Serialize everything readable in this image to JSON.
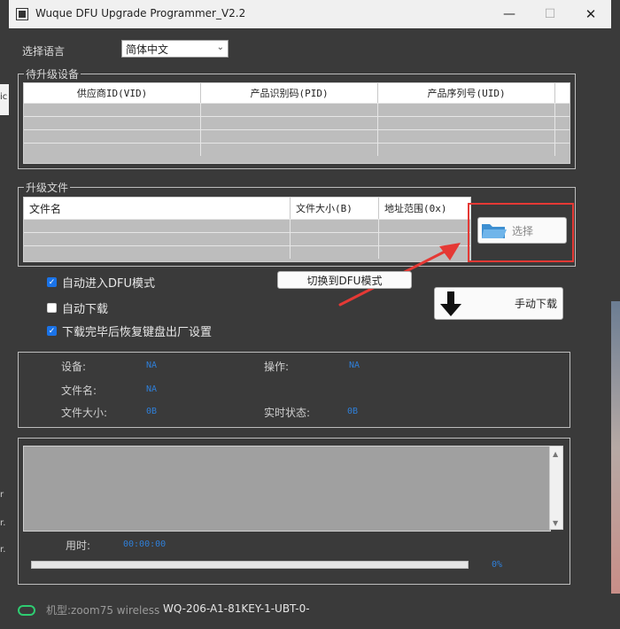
{
  "window": {
    "title": "Wuque DFU Upgrade Programmer_V2.2",
    "controls": {
      "minimize": "—",
      "maximize": "☐",
      "close": "✕"
    }
  },
  "language": {
    "label": "选择语言",
    "selected": "简体中文"
  },
  "devices": {
    "group_title": "待升级设备",
    "columns": [
      "供应商ID(VID)",
      "产品识别码(PID)",
      "产品序列号(UID)"
    ]
  },
  "firmware": {
    "group_title": "升级文件",
    "columns": [
      "文件名",
      "文件大小(B)",
      "地址范围(0x)"
    ],
    "select_button": "选择"
  },
  "options": {
    "auto_dfu": {
      "label": "自动进入DFU模式",
      "checked": true
    },
    "auto_download": {
      "label": "自动下载",
      "checked": false
    },
    "restore": {
      "label": "下载完毕后恢复键盘出厂设置",
      "checked": true
    }
  },
  "actions": {
    "switch_dfu": "切换到DFU模式",
    "manual_download": "手动下载"
  },
  "status": {
    "device_label": "设备:",
    "device_value": "NA",
    "operation_label": "操作:",
    "operation_value": "NA",
    "filename_label": "文件名:",
    "filename_value": "NA",
    "filesize_label": "文件大小:",
    "filesize_value": "0B",
    "realtime_label": "实时状态:",
    "realtime_value": "0B"
  },
  "log": {
    "elapsed_label": "用时:",
    "elapsed_value": "00:00:00",
    "progress_percent": "0%",
    "progress": 0
  },
  "footer": {
    "model_label": "机型:zoom75 wireless",
    "model_code": "WQ-206-A1-81KEY-1-UBT-0-"
  },
  "background_fragments": [
    "ic",
    "r",
    "r.",
    "r."
  ],
  "colors": {
    "highlight": "#e53935",
    "accent": "#1a73e8",
    "value": "#2f7fd8",
    "status_led": "#2ecc71"
  }
}
